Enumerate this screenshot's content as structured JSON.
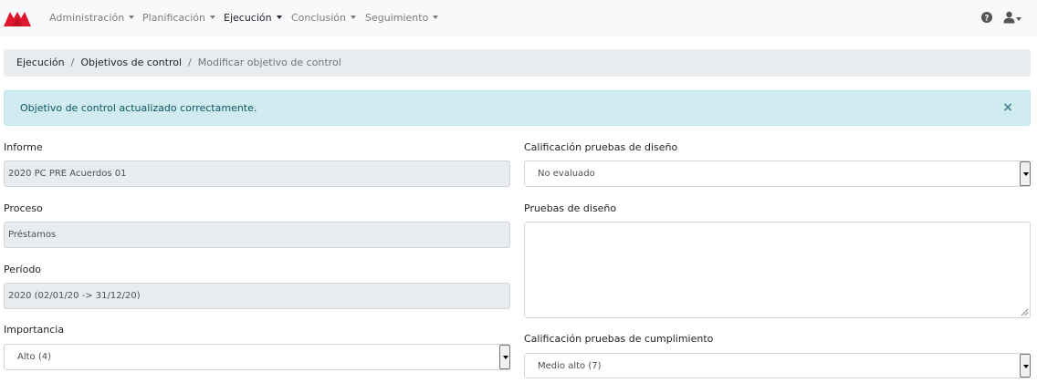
{
  "nav": {
    "items": [
      {
        "label": "Administración",
        "active": false
      },
      {
        "label": "Planificación",
        "active": false
      },
      {
        "label": "Ejecución",
        "active": true
      },
      {
        "label": "Conclusión",
        "active": false
      },
      {
        "label": "Seguimiento",
        "active": false
      }
    ],
    "logo_icon": "brand-logo",
    "help_icon": "question-circle-icon",
    "user_icon": "user-icon",
    "brand_color": "#e0182d"
  },
  "breadcrumb": {
    "items": [
      "Ejecución",
      "Objetivos de control",
      "Modificar objetivo de control"
    ],
    "separator": "/"
  },
  "alert": {
    "message": "Objetivo de control actualizado correctamente.",
    "close": "×",
    "background": "#d1ecf1"
  },
  "form": {
    "informe": {
      "label": "Informe",
      "value": "2020 PC PRE Acuerdos 01"
    },
    "proceso": {
      "label": "Proceso",
      "value": "Préstamos"
    },
    "periodo": {
      "label": "Período",
      "value": "2020 (02/01/20 -> 31/12/20)"
    },
    "importancia": {
      "label": "Importancia",
      "value": "Alto (4)"
    },
    "calif_diseno": {
      "label": "Calificación pruebas de diseño",
      "value": "No evaluado"
    },
    "pruebas_diseno": {
      "label": "Pruebas de diseño",
      "value": ""
    },
    "calif_cumplimiento": {
      "label": "Calificación pruebas de cumplimiento",
      "value": "Medio alto (7)"
    }
  }
}
